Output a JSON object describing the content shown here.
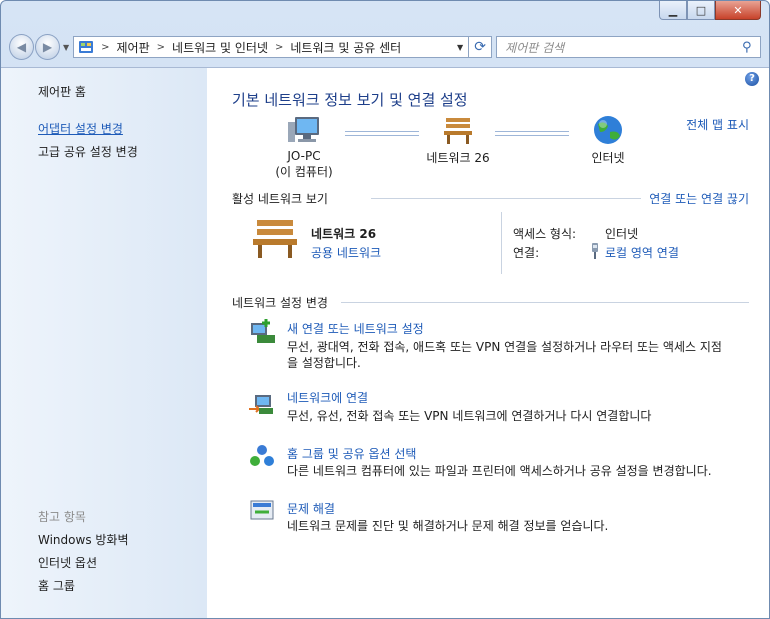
{
  "breadcrumbs": [
    "제어판",
    "네트워크 및 인터넷",
    "네트워크 및 공유 센터"
  ],
  "search": {
    "placeholder": "제어판 검색"
  },
  "sidebar": {
    "home": "제어판 홈",
    "links": [
      "어댑터 설정 변경",
      "고급 공유 설정 변경"
    ],
    "see_also_header": "참고 항목",
    "see_also": [
      "Windows 방화벽",
      "인터넷 옵션",
      "홈 그룹"
    ]
  },
  "main": {
    "title": "기본 네트워크 정보 보기 및 연결 설정",
    "full_map": "전체 맵 표시",
    "map": {
      "pc_name": "JO-PC",
      "pc_sub": "(이 컴퓨터)",
      "network": "네트워크  26",
      "internet": "인터넷"
    },
    "active": {
      "header": "활성 네트워크 보기",
      "connect_link": "연결 또는 연결 끊기",
      "network_name": "네트워크  26",
      "network_type": "공용 네트워크",
      "access_label": "액세스 형식:",
      "access_value": "인터넷",
      "conn_label": "연결:",
      "conn_value": "로컬 영역 연결"
    },
    "change": {
      "header": "네트워크 설정 변경",
      "tasks": [
        {
          "title": "새 연결 또는 네트워크 설정",
          "desc1": "무선, 광대역, 전화 접속, 애드혹 또는 VPN 연결을 설정하거나 라우터 또는 액세스 지점",
          "desc2": "을 설정합니다."
        },
        {
          "title": "네트워크에 연결",
          "desc1": "무선, 유선, 전화 접속 또는 VPN 네트워크에 연결하거나 다시 연결합니다",
          "desc2": ""
        },
        {
          "title": "홈 그룹 및 공유 옵션 선택",
          "desc1": "다른 네트워크 컴퓨터에 있는 파일과 프린터에 액세스하거나 공유 설정을 변경합니다.",
          "desc2": ""
        },
        {
          "title": "문제 해결",
          "desc1": "네트워크 문제를 진단 및 해결하거나 문제 해결 정보를 얻습니다.",
          "desc2": ""
        }
      ]
    }
  }
}
